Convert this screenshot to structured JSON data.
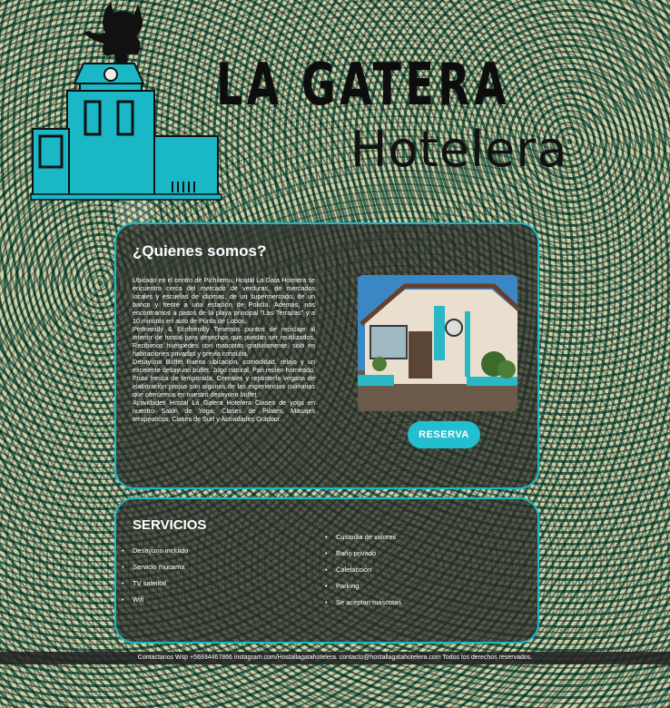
{
  "brand": {
    "title": "LA GATERA",
    "subtitle": "Hotelera",
    "logo_icon": "house-with-cat-icon",
    "accent": "#1ab7c6"
  },
  "about": {
    "heading": "¿Quienes somos?",
    "paragraphs": [
      "Ubicado en el centro de Pichilemu, Hostal La Gata Hotelera se encuentra cerca del mercado de verduras, de mercados locales y escuelas de idiomas, de un supermercado, de un banco y frente a una estación de Policía. Además, nos encontramos a pasos de la playa principal \"Las Terrazas\" y a 10 minutos en auto de Punta de Lobos.",
      "Petfriendly & Ecofriendly Tenemos puntos de reciclaje al interior de hostal para desechos que puedan ser reutilizados. Recibimos huéspedes con mascotas gratuitamente, sólo en habitaciones privadas y previa consulta.",
      "Desayuno Buffet Buena ubicación, comodidad, relajo y un excelente desayuno buffet. Jugo natural, Pan recién horneado, Fruta fresca de temporada, Cereales y repostería vegana de elaboración propia son algunas de las experiencias culinarias que ofrecemos en nuestro desayuno buffet.",
      "Actividades Hostal La Gatera Hotelera Clases de yoga en nuestro Salón de Yoga, Clases de Pilates, Masajes terapéuticos, Clases de Surf y Actividades Outdoor."
    ],
    "reserve_label": "RESERVA"
  },
  "services": {
    "heading": "SERVICIOS",
    "left": [
      "Desayuno incluido",
      "Servicio mucama",
      "TV satelital",
      "Wifi"
    ],
    "right": [
      "Custodia de valores",
      "Baño privado",
      "Calefacción",
      "Parking",
      "Se aceptan mascotas"
    ]
  },
  "footer": {
    "text": "Contactanos Wsp +56934467866 instagram.com/Hostallagatahotelera. contacto@hostallagatahotelera.com Todos los derechos reservados."
  }
}
